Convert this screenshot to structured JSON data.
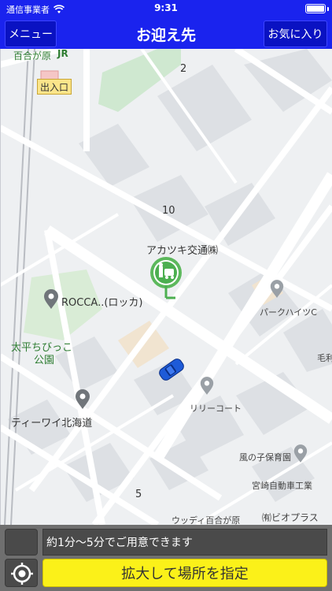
{
  "status_bar": {
    "carrier": "通信事業者",
    "time": "9:31"
  },
  "header": {
    "title": "お迎え先",
    "menu_label": "メニュー",
    "favorites_label": "お気に入り"
  },
  "map": {
    "labels": {
      "station_name": "百合が原",
      "station_logo": "JR",
      "station_exit": "出入口",
      "block_2": "2",
      "block_10": "10",
      "block_5": "5",
      "taxi_company": "アカツキ交通㈱",
      "rocca": "ROCCA..(ロッカ)",
      "park_heights": "パークハイツC",
      "park_name_line1": "太平ちびっこ",
      "park_name_line2": "公園",
      "lily_court": "リリーコート",
      "tiwai": "ティーワイ北海道",
      "kaze_nursery": "風の子保育園",
      "miyazaki_school": "宮崎自動車工業",
      "woody": "ウッディ百合が原",
      "bioplus": "㈲ビオプラス",
      "mo": "毛利"
    },
    "icons": [
      "taxi-station-pin-icon",
      "car-icon",
      "place-pin-icon"
    ],
    "colors": {
      "background": "#eef0f2",
      "road": "#ffffff",
      "building": "#dde0e4",
      "park": "#cfe8d0",
      "pin_green": "#4caf50",
      "car_blue": "#1e5bd8"
    }
  },
  "bottom": {
    "wait_info": "約1分〜5分でご用意できます",
    "specify_button": "拡大して場所を指定"
  },
  "colors": {
    "header_bg": "#1a23ee",
    "button_yellow": "#fbf119",
    "panel_gray": "#6f6f6f"
  }
}
